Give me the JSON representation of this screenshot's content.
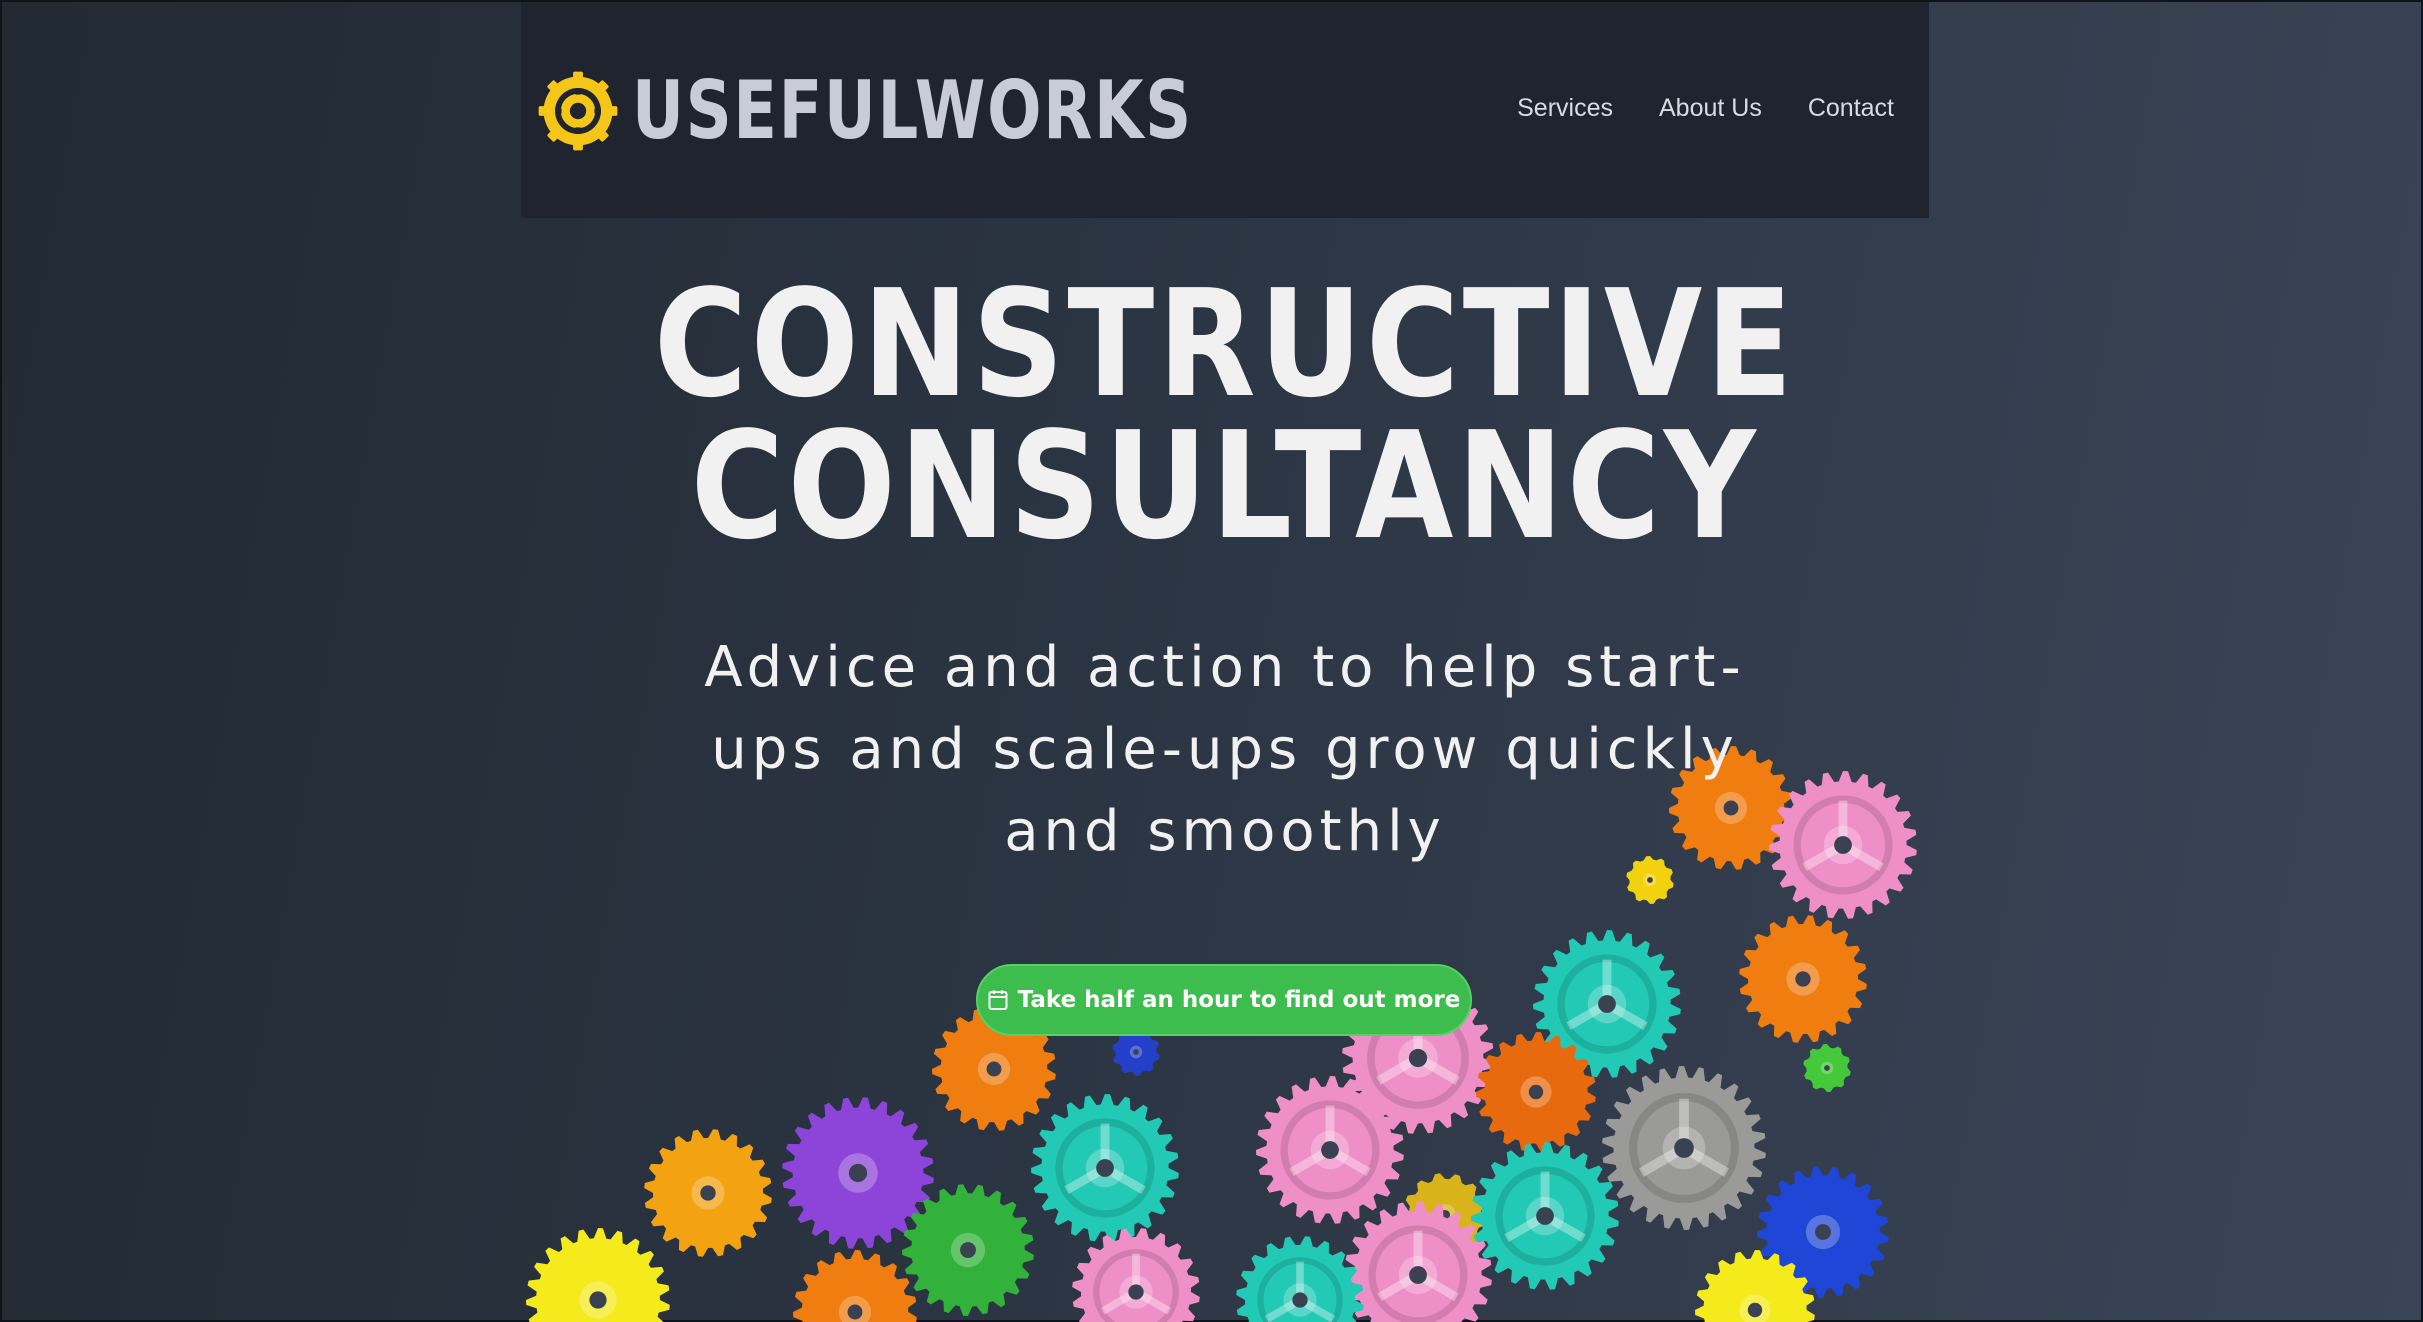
{
  "header": {
    "brand": "USEFULWORKS",
    "logo_icon": "gear-logo-icon",
    "nav": [
      {
        "label": "Services"
      },
      {
        "label": "About Us"
      },
      {
        "label": "Contact"
      }
    ]
  },
  "hero": {
    "title_line1": "CONSTRUCTIVE",
    "title_line2": "CONSULTANCY",
    "subtitle": "Advice and action to help start-ups and scale-ups grow quickly and smoothly",
    "cta_label": "Take half an hour to find out more",
    "cta_icon": "calendar-icon",
    "background_image": "colorful-plastic-gears-image"
  },
  "colors": {
    "header_bg": "#1f242f",
    "logo_yellow": "#f5c518",
    "cta_green": "#3ebd4f",
    "text": "#f1f1f1"
  }
}
